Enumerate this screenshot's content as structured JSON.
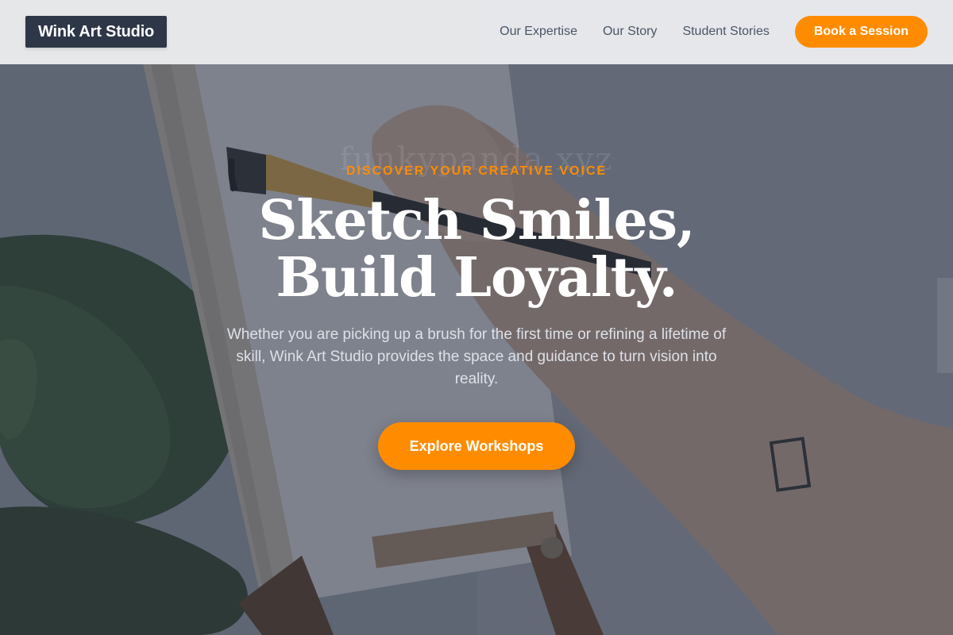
{
  "nav": {
    "brand": "Wink Art Studio",
    "links": [
      {
        "label": "Our Expertise"
      },
      {
        "label": "Our Story"
      },
      {
        "label": "Student Stories"
      }
    ],
    "cta_label": "Book a Session"
  },
  "hero": {
    "eyebrow": "DISCOVER YOUR CREATIVE VOICE",
    "headline_line1": "Sketch Smiles,",
    "headline_line2": "Build Loyalty.",
    "watermark": "funkypanda.xyz",
    "lead": "Whether you are picking up a brush for the first time or refining a lifetime of skill, Wink Art Studio provides the space and guidance to turn vision into reality.",
    "cta_label": "Explore Workshops",
    "background_image": "painting-at-easel-photo"
  },
  "colors": {
    "accent": "#ff8c00",
    "brand_bg": "#2d3748",
    "nav_text": "#4a5568",
    "nav_bg": "#ebecee",
    "headline": "#ffffff"
  }
}
